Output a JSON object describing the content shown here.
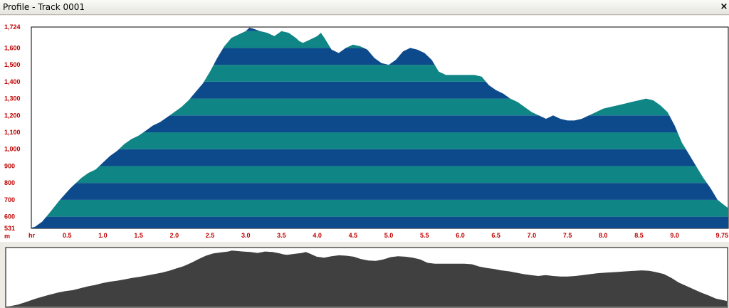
{
  "window": {
    "title": "Profile - Track 0001",
    "close_label": "x"
  },
  "chart_data": {
    "type": "area",
    "x_unit_label": "hr",
    "y_unit_label": "m",
    "xlim": [
      0,
      9.75
    ],
    "ylim": [
      531,
      1724
    ],
    "y_ticks": [
      "531",
      "600",
      "700",
      "800",
      "900",
      "1,000",
      "1,100",
      "1,200",
      "1,300",
      "1,400",
      "1,500",
      "1,600",
      "1,724"
    ],
    "y_tick_values": [
      531,
      600,
      700,
      800,
      900,
      1000,
      1100,
      1200,
      1300,
      1400,
      1500,
      1600,
      1724
    ],
    "x_ticks": [
      "0.5",
      "1.0",
      "1.5",
      "2.0",
      "2.5",
      "3.0",
      "3.5",
      "4.0",
      "4.5",
      "5.0",
      "5.5",
      "6.0",
      "6.5",
      "7.0",
      "7.5",
      "8.0",
      "8.5",
      "9.0",
      "9.75"
    ],
    "x_tick_values": [
      0.5,
      1.0,
      1.5,
      2.0,
      2.5,
      3.0,
      3.5,
      4.0,
      4.5,
      5.0,
      5.5,
      6.0,
      6.5,
      7.0,
      7.5,
      8.0,
      8.5,
      9.0,
      9.75
    ],
    "band_colors": [
      "#0d4a8c",
      "#0f8585"
    ],
    "band_step": 100,
    "overview_color": "#404040",
    "grid": false,
    "x": [
      0,
      0.05,
      0.15,
      0.25,
      0.4,
      0.55,
      0.7,
      0.8,
      0.9,
      1.0,
      1.1,
      1.2,
      1.3,
      1.4,
      1.5,
      1.6,
      1.7,
      1.8,
      1.9,
      2.0,
      2.1,
      2.2,
      2.3,
      2.4,
      2.5,
      2.6,
      2.7,
      2.8,
      2.9,
      3.0,
      3.05,
      3.1,
      3.2,
      3.3,
      3.4,
      3.5,
      3.6,
      3.7,
      3.75,
      3.8,
      3.9,
      4.0,
      4.05,
      4.1,
      4.2,
      4.3,
      4.4,
      4.5,
      4.6,
      4.7,
      4.8,
      4.9,
      5.0,
      5.1,
      5.2,
      5.3,
      5.4,
      5.5,
      5.6,
      5.7,
      5.8,
      5.9,
      6.0,
      6.1,
      6.2,
      6.3,
      6.4,
      6.5,
      6.6,
      6.7,
      6.8,
      6.9,
      7.0,
      7.1,
      7.2,
      7.3,
      7.4,
      7.5,
      7.6,
      7.7,
      7.8,
      7.9,
      8.0,
      8.1,
      8.2,
      8.3,
      8.4,
      8.5,
      8.6,
      8.7,
      8.8,
      8.9,
      9.0,
      9.1,
      9.2,
      9.3,
      9.4,
      9.5,
      9.6,
      9.75
    ],
    "y": [
      535,
      540,
      570,
      620,
      700,
      770,
      830,
      860,
      880,
      920,
      960,
      990,
      1030,
      1060,
      1080,
      1110,
      1140,
      1160,
      1190,
      1220,
      1250,
      1290,
      1340,
      1390,
      1460,
      1540,
      1610,
      1660,
      1680,
      1700,
      1720,
      1715,
      1700,
      1690,
      1670,
      1700,
      1690,
      1660,
      1640,
      1630,
      1650,
      1670,
      1690,
      1660,
      1590,
      1570,
      1600,
      1620,
      1610,
      1590,
      1540,
      1510,
      1500,
      1530,
      1580,
      1600,
      1590,
      1570,
      1530,
      1460,
      1440,
      1440,
      1440,
      1440,
      1440,
      1430,
      1380,
      1350,
      1330,
      1300,
      1280,
      1250,
      1220,
      1200,
      1180,
      1200,
      1180,
      1170,
      1170,
      1180,
      1200,
      1220,
      1240,
      1250,
      1260,
      1270,
      1280,
      1290,
      1300,
      1290,
      1260,
      1220,
      1140,
      1040,
      970,
      900,
      830,
      770,
      700,
      650
    ]
  }
}
